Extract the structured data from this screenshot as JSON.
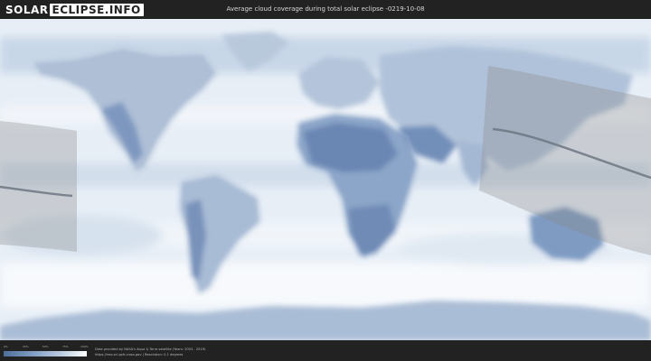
{
  "header": {
    "logo_part1": "SOLAR",
    "logo_part2": "ECLIPSE.INFO",
    "title": "Average cloud coverage during total solar eclipse -0219-10-08"
  },
  "map": {
    "background_color": "#ffffff",
    "land_cloud_color": "#6f8fb8",
    "ocean_cloud_color": "#dbe6f1",
    "eclipse_band_color": "#8a8a8a",
    "center_line_color": "#6d7581"
  },
  "legend": {
    "ticks": [
      "0%",
      "25%",
      "50%",
      "75%",
      "100%"
    ],
    "gradient_colors": [
      "#4f6f99",
      "#7e9ac0",
      "#b6c8de",
      "#ffffff"
    ]
  },
  "footer": {
    "credit_line1": "Data provided by NASA's Aqua & Terra satellite (Years: 2003 - 2019)",
    "credit_line2": "https://neo.sci.gsfc.nasa.gov | Resolution: 0.1 degrees"
  }
}
